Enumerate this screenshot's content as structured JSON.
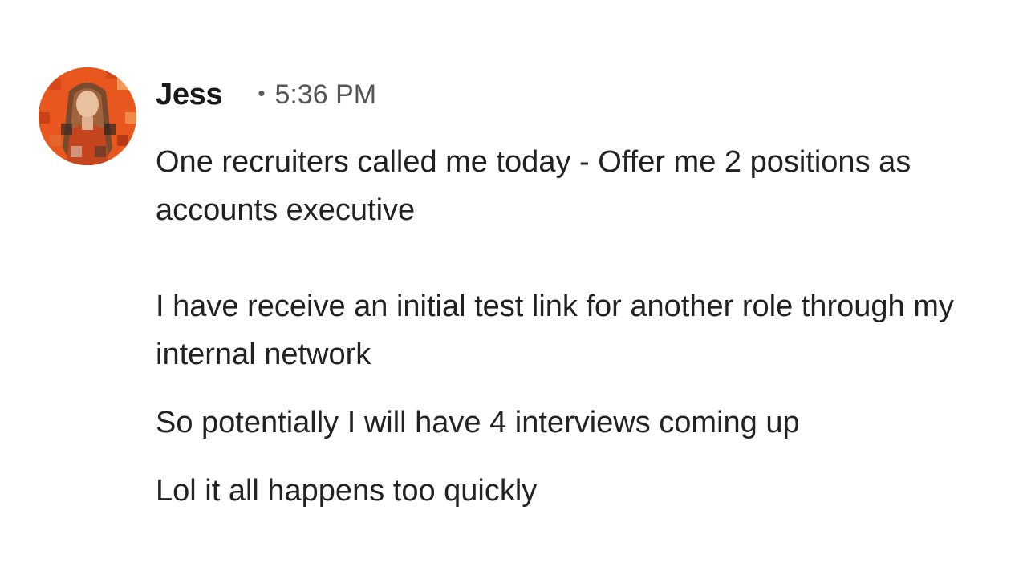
{
  "message": {
    "author": "Jess",
    "separator": "•",
    "timestamp": "5:36 PM",
    "avatar_icon": "profile-photo-pixelated",
    "paragraphs": [
      "One recruiters called me today - Offer me 2 positions as accounts executive",
      "I have receive an initial test link for another role through my internal network",
      "So potentially I will have 4 interviews coming up",
      "Lol it all happens too quickly"
    ]
  },
  "colors": {
    "avatar_accent": "#e8571e",
    "author_text": "#1a1a1a",
    "timestamp_text": "#555555",
    "body_text": "#222222"
  }
}
